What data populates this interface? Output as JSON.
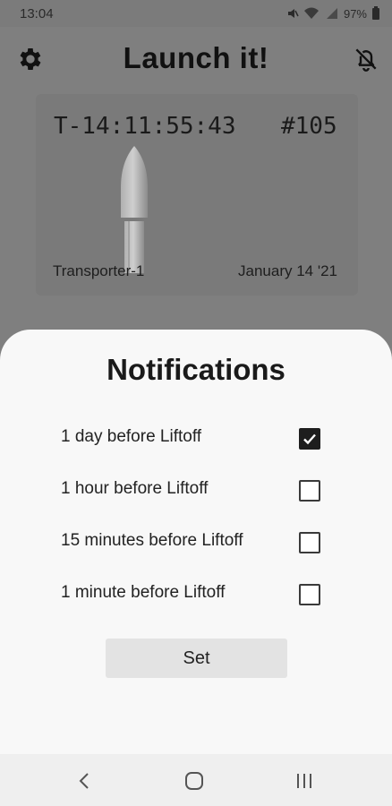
{
  "status_bar": {
    "time": "13:04",
    "battery": "97%"
  },
  "app": {
    "title": "Launch it!",
    "icons": [
      "gear-icon",
      "bell-off-icon"
    ]
  },
  "launch_card": {
    "countdown": "T-14:11:55:43",
    "launch_number": "#105",
    "mission": "Transporter-1",
    "date": "January 14 '21"
  },
  "notifications_sheet": {
    "title": "Notifications",
    "options": [
      {
        "label": "1 day before Liftoff",
        "checked": true
      },
      {
        "label": "1 hour before Liftoff",
        "checked": false
      },
      {
        "label": "15 minutes before Liftoff",
        "checked": false
      },
      {
        "label": "1 minute before Liftoff",
        "checked": false
      }
    ],
    "set_label": "Set"
  },
  "nav_bar": {
    "icons": [
      "back-icon",
      "home-icon",
      "recents-icon"
    ]
  }
}
